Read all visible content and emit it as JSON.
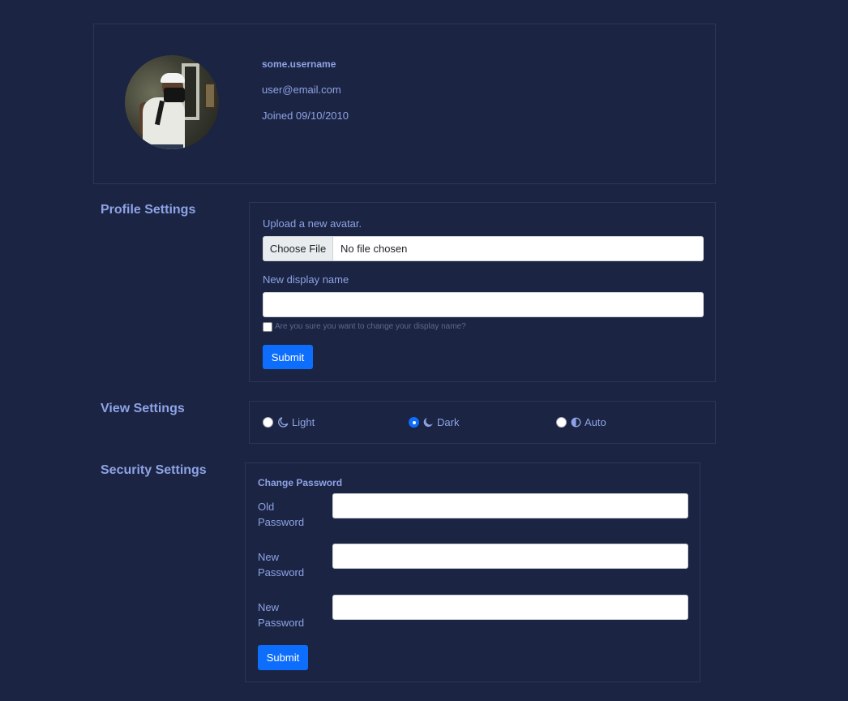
{
  "profile": {
    "username": "some.username",
    "email": "user@email.com",
    "joined": "Joined 09/10/2010"
  },
  "profile_settings": {
    "title": "Profile Settings",
    "upload_label": "Upload a new avatar.",
    "choose_file": "Choose File",
    "no_file": "No file chosen",
    "display_name_label": "New display name",
    "display_name_value": "",
    "confirm_note": "Are you sure you want to change your display name?",
    "submit": "Submit"
  },
  "view_settings": {
    "title": "View Settings",
    "options": [
      {
        "label": "Light",
        "icon": "moon-icon",
        "checked": false
      },
      {
        "label": "Dark",
        "icon": "moon-icon",
        "checked": true
      },
      {
        "label": "Auto",
        "icon": "half-circle-icon",
        "checked": false
      }
    ]
  },
  "security_settings": {
    "title": "Security Settings",
    "heading": "Change Password",
    "fields": [
      {
        "label_line1": "Old",
        "label_line2": "Password",
        "value": ""
      },
      {
        "label_line1": "New",
        "label_line2": "Password",
        "value": ""
      },
      {
        "label_line1": "New",
        "label_line2": "Password",
        "value": ""
      }
    ],
    "submit": "Submit"
  },
  "colors": {
    "background": "#1b2442",
    "text": "#8ea3e6",
    "accent": "#0d6efd",
    "border": "#2b3658"
  }
}
